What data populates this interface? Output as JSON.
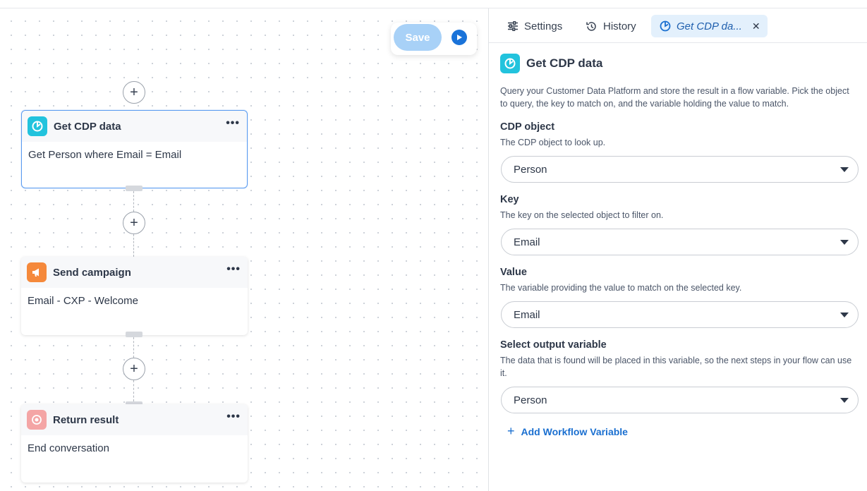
{
  "toolbar": {
    "save_label": "Save"
  },
  "flow": {
    "nodes": [
      {
        "title": "Get CDP data",
        "body": "Get Person where Email = Email",
        "icon": "cdp-icon",
        "color": "#22c3dd"
      },
      {
        "title": "Send campaign",
        "body": "Email - CXP - Welcome",
        "icon": "megaphone-icon",
        "color": "#f5893b"
      },
      {
        "title": "Return result",
        "body": "End conversation",
        "icon": "target-icon",
        "color": "#f4a5a5"
      }
    ]
  },
  "panel": {
    "tabs": [
      {
        "label": "Settings",
        "icon": "sliders-icon"
      },
      {
        "label": "History",
        "icon": "history-icon"
      },
      {
        "label": "Get CDP da...",
        "icon": "cdp-icon"
      }
    ],
    "title": "Get CDP data",
    "description": "Query your Customer Data Platform and store the result in a flow variable. Pick the object to query, the key to match on, and the variable holding the value to match.",
    "fields": [
      {
        "label": "CDP object",
        "help": "The CDP object to look up.",
        "value": "Person"
      },
      {
        "label": "Key",
        "help": "The key on the selected object to filter on.",
        "value": "Email"
      },
      {
        "label": "Value",
        "help": "The variable providing the value to match on the selected key.",
        "value": "Email"
      },
      {
        "label": "Select output variable",
        "help": "The data that is found will be placed in this variable, so the next steps in your flow can use it.",
        "value": "Person"
      }
    ],
    "add_variable_label": "Add Workflow Variable"
  },
  "colors": {
    "accent": "#1a73d9",
    "selected_border": "#5b9cf0",
    "active_tab_bg": "#e3f0fc"
  }
}
